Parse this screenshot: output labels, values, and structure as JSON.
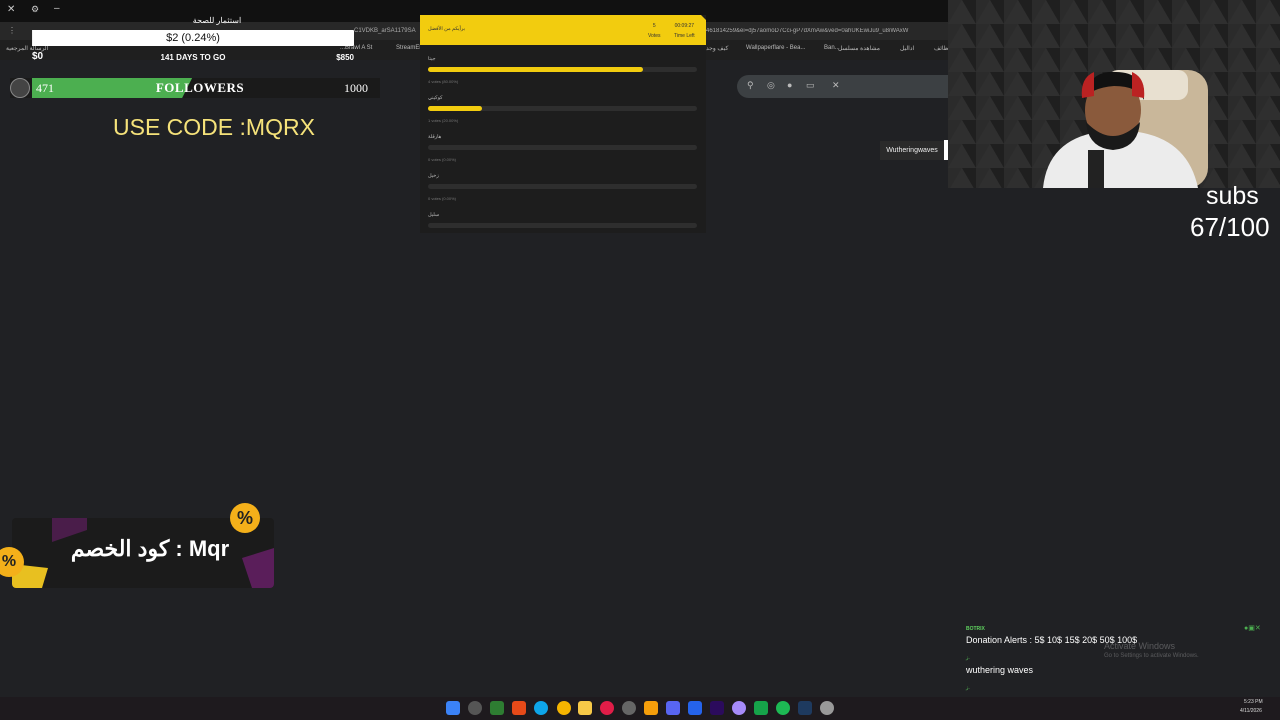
{
  "browser": {
    "url_left": "C1VDKB_arSA1179SA",
    "url_right": "461814259&ei=dj57aomoD7Cci-gP7dXmAw&ved=0ahUKEwiJu9_u8iWAxW",
    "bookmarks": [
      "الرسالة المرجعية",
      "StreamEl",
      "...Brawl A St",
      "كيف وجد",
      "Wallpaperflare - Bea...",
      "Ban...",
      "مشاهدة مسلسل",
      "اداليل",
      "وظائف"
    ]
  },
  "goal": {
    "title": "استثمار للصحة",
    "amount": "$2 (0.24%)",
    "progress": 0.0024,
    "start": "$0",
    "days_left": "141 DAYS TO GO",
    "target": "$850"
  },
  "followers": {
    "current": "471",
    "label": "FOLLOWERS",
    "goal": "1000",
    "progress": 0.471
  },
  "use_code": "USE CODE :MQRX",
  "poll": {
    "title": "برأيكم من الأفضل",
    "votes_count": "5",
    "votes_label": "Votes",
    "time_value": "00:09:27",
    "time_label": "Time Left",
    "options": [
      {
        "label": "جيتا",
        "votes": "4 votes (80.00%)",
        "percent": 80
      },
      {
        "label": "كوكيني",
        "votes": "1 votes (20.00%)",
        "percent": 20
      },
      {
        "label": "هارقلة",
        "votes": "0 votes (0.00%)",
        "percent": 0
      },
      {
        "label": "زخيل",
        "votes": "0 votes (0.00%)",
        "percent": 0
      },
      {
        "label": "سليل",
        "votes": "",
        "percent": 0
      }
    ]
  },
  "search_tag": "Wutheringwaves",
  "subs": {
    "label": "subs",
    "count": "67/100"
  },
  "discount": {
    "text": "كود الخصم : Mqr",
    "badge": "%"
  },
  "chat": {
    "user1": "BOTRIX",
    "msg1": "Donation Alerts : 5$ 10$ 15$ 20$ 50$ 100$",
    "user2": "ز.",
    "msg2": "wuthering waves",
    "user3": "ز."
  },
  "windows": {
    "activate_title": "Activate Windows",
    "activate_sub": "Go to Settings to activate Windows."
  },
  "taskbar": {
    "time": "5:23 PM",
    "date": "4/11/2026"
  },
  "colors": {
    "poll_yellow": "#f2cc0f",
    "followers_green": "#4caf50",
    "code_yellow": "#f5e27a",
    "badge_orange": "#f4b01a"
  }
}
